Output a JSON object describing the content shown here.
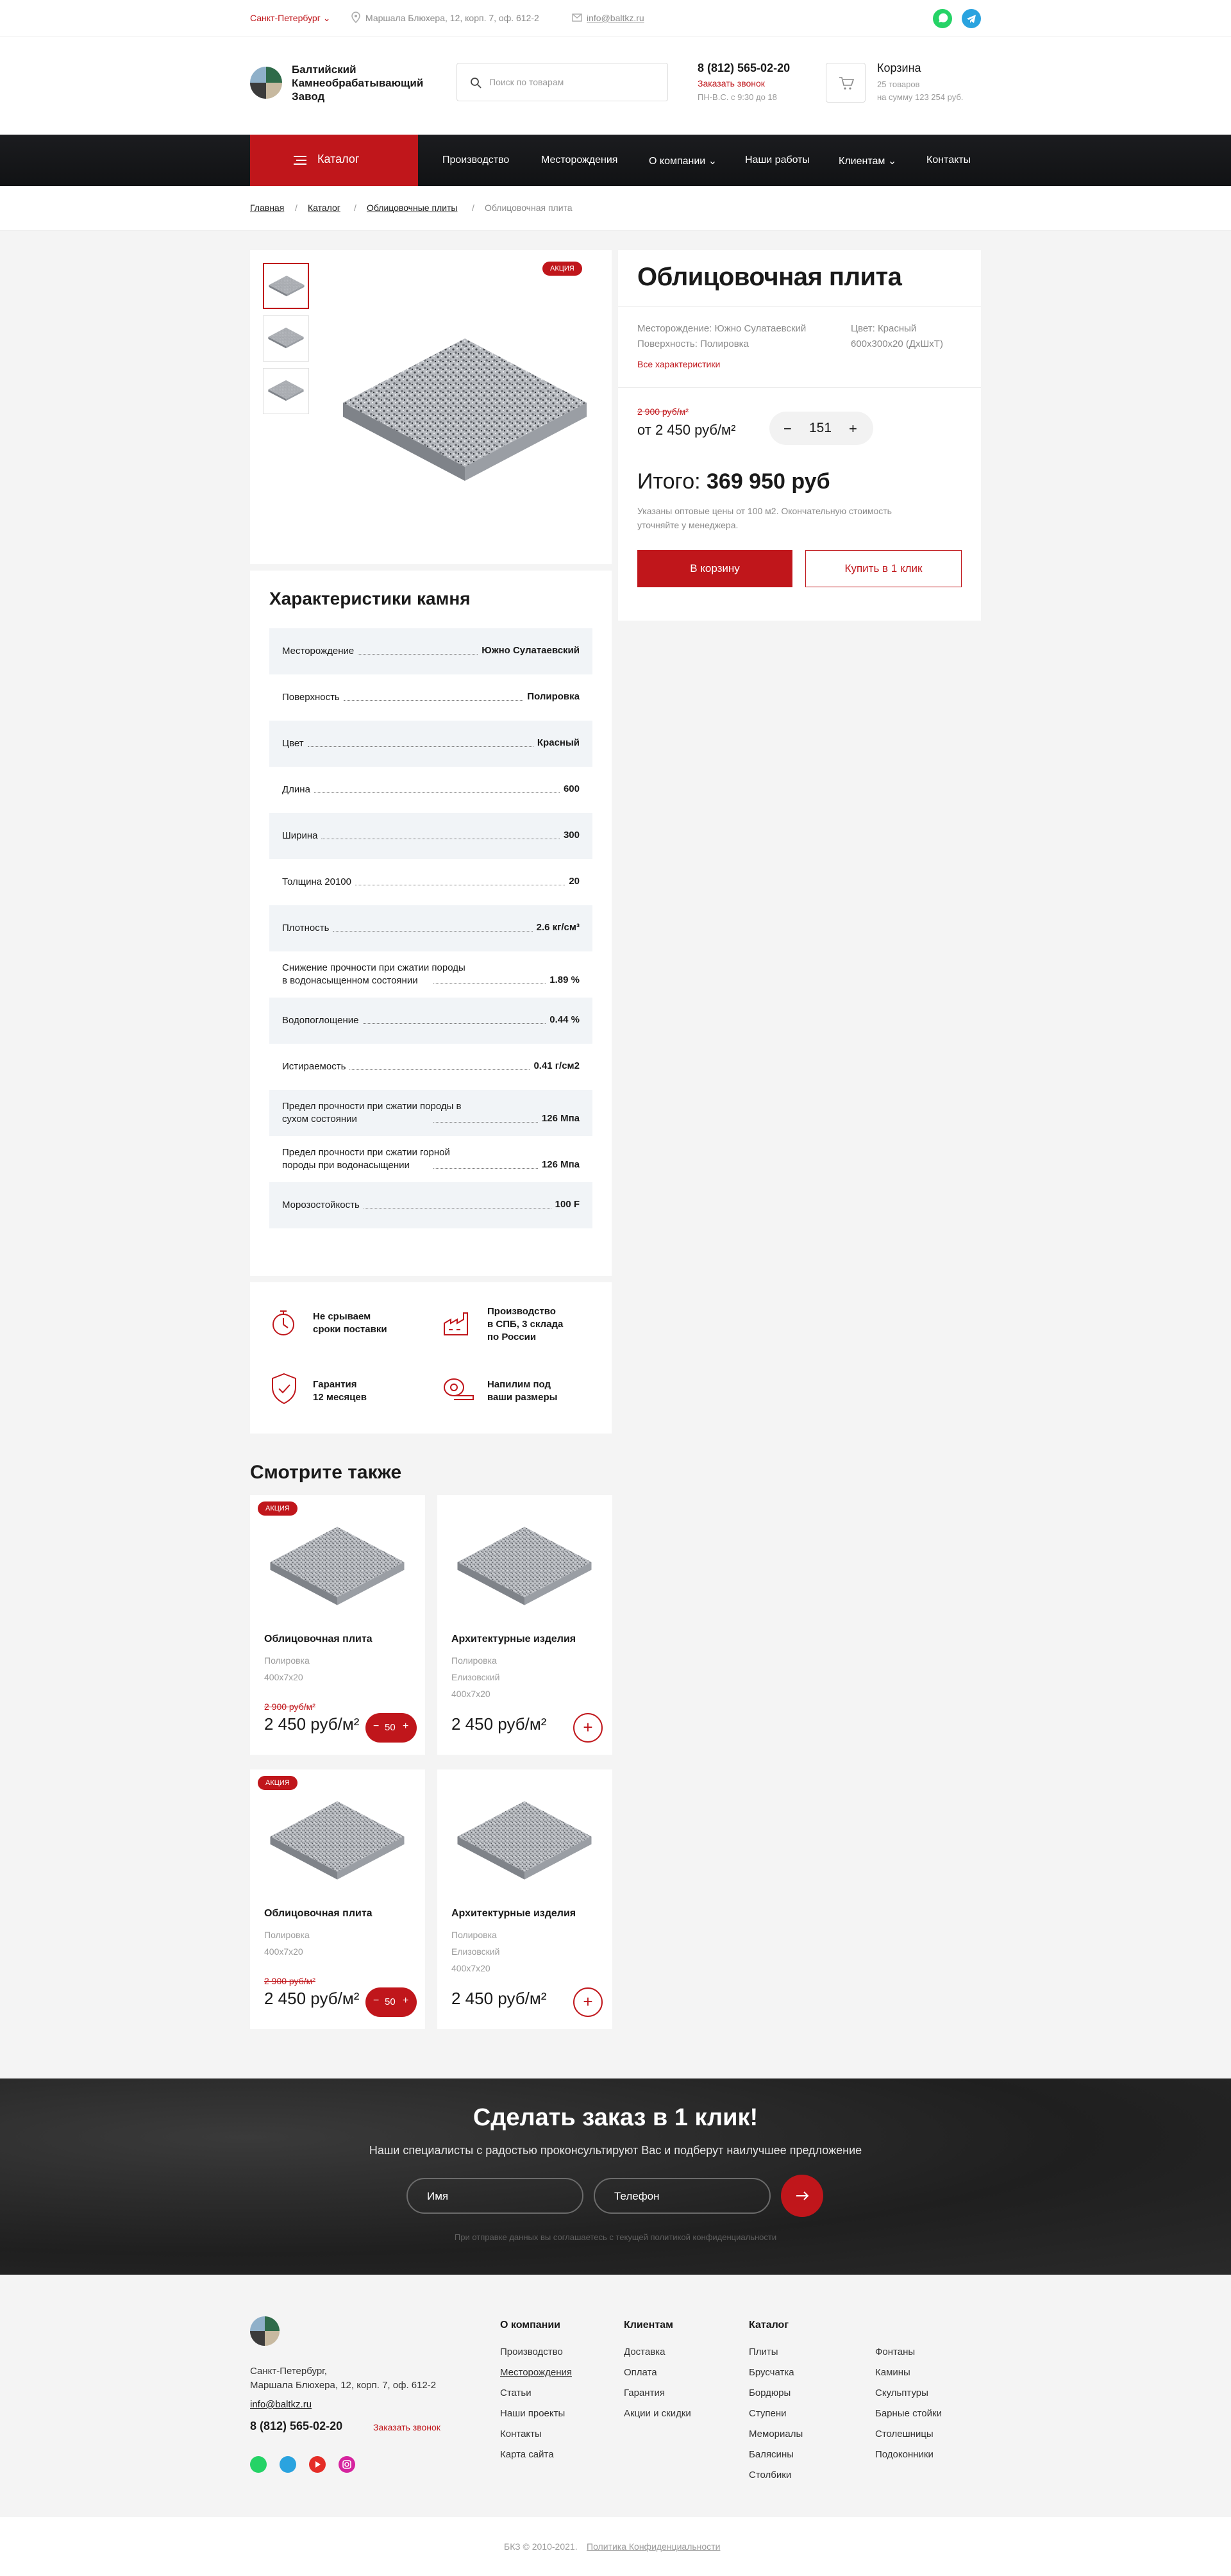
{
  "topbar": {
    "city": "Санкт-Петербург",
    "address": "Маршала Блюхера, 12, корп. 7, оф. 612-2",
    "email": "info@baltkz.ru",
    "whatsapp_color": "#25d366",
    "telegram_color": "#2aa3df"
  },
  "header": {
    "brand_line1": "Балтийский",
    "brand_line2": "Камнеобрабатывающий",
    "brand_line3": "Завод",
    "search_placeholder": "Поиск по товарам",
    "phone": "8 (812) 565-02-20",
    "callback": "Заказать звонок",
    "hours": "ПН-В.С. с 9:30 до 18",
    "cart_title": "Корзина",
    "cart_count": "25 товаров",
    "cart_sum": "на сумму 123 254 руб."
  },
  "nav": {
    "catalog": "Каталог",
    "items": [
      "Производство",
      "Месторождения",
      "О компании",
      "Наши работы",
      "Клиентам",
      "Контакты"
    ]
  },
  "breadcrumb": [
    "Главная",
    "Каталог",
    "Облицовочные плиты",
    "Облицовочная плита"
  ],
  "product": {
    "badge": "АКЦИЯ",
    "title": "Облицовочная плита",
    "deposit": "Месторождение: Южно Сулатаевский",
    "surface": "Поверхность: Полировка",
    "color": "Цвет: Красный",
    "size": "600х300х20 (ДхШхТ)",
    "all_chars": "Все характеристики",
    "old_price": "2 900 руб/м²",
    "price": "от 2 450 руб/м²",
    "qty_minus": "−",
    "qty": "151",
    "qty_plus": "+",
    "total_label": "Итого:",
    "total": "369 950 руб",
    "note": "Указаны оптовые цены от 100 м2. Окончательную стоимость уточняйте у менеджера.",
    "to_cart": "В корзину",
    "one_click": "Купить в 1 клик"
  },
  "specs": {
    "title": "Характеристики камня",
    "rows": [
      {
        "label": "Месторождение",
        "value": "Южно Сулатаевский"
      },
      {
        "label": "Поверхность",
        "value": "Полировка"
      },
      {
        "label": "Цвет",
        "value": "Красный"
      },
      {
        "label": "Длина",
        "value": "600"
      },
      {
        "label": "Ширина",
        "value": "300"
      },
      {
        "label": "Толщина 20100",
        "value": "20"
      },
      {
        "label": "Плотность",
        "value": "2.6 кг/см³"
      },
      {
        "label": "Снижение прочности при сжатии породы в водонасыщенном состоянии",
        "value": "1.89 %"
      },
      {
        "label": "Водопоглощение",
        "value": "0.44 %"
      },
      {
        "label": "Истираемость",
        "value": "0.41 г/см2"
      },
      {
        "label": "Предел прочности при сжатии породы в сухом состоянии",
        "value": "126 Мпа"
      },
      {
        "label": "Предел прочности при сжатии горной породы при водонасыщении",
        "value": "126 Мпа"
      },
      {
        "label": "Морозостойкость",
        "value": "100 F"
      }
    ]
  },
  "advantages": [
    {
      "line1": "Не срываем",
      "line2": "сроки поставки",
      "line3": ""
    },
    {
      "line1": "Производство",
      "line2": "в СПБ, 3 склада",
      "line3": "по России"
    },
    {
      "line1": "Гарантия",
      "line2": "12 месяцев",
      "line3": ""
    },
    {
      "line1": "Напилим под",
      "line2": "ваши размеры",
      "line3": ""
    }
  ],
  "see_also": {
    "title": "Смотрите также",
    "cards": [
      {
        "badge": "АКЦИЯ",
        "name": "Облицовочная плита",
        "d1": "Полировка",
        "d2": "400х7х20",
        "d3": "",
        "old": "2 900 руб/м²",
        "price": "2 450 руб/м²",
        "qty": "50"
      },
      {
        "badge": "",
        "name": "Архитектурные изделия",
        "d1": "Полировка",
        "d2": "Елизовский",
        "d3": "400х7х20",
        "old": "",
        "price": "2 450 руб/м²",
        "qty": ""
      },
      {
        "badge": "АКЦИЯ",
        "name": "Облицовочная плита",
        "d1": "Полировка",
        "d2": "400х7х20",
        "d3": "",
        "old": "2 900 руб/м²",
        "price": "2 450 руб/м²",
        "qty": "50"
      },
      {
        "badge": "",
        "name": "Архитектурные изделия",
        "d1": "Полировка",
        "d2": "Елизовский",
        "d3": "400х7х20",
        "old": "",
        "price": "2 450 руб/м²",
        "qty": ""
      }
    ]
  },
  "order": {
    "title": "Сделать заказ в 1 клик!",
    "subtitle": "Наши специалисты с радостью проконсультируют Вас и подберут наилучшее предложение",
    "name_ph": "Имя",
    "phone_ph": "Телефон",
    "policy": "При отправке данных вы соглашаетесь с текущей политикой конфиденциальности"
  },
  "footer": {
    "address1": "Санкт-Петербург,",
    "address2": "Маршала Блюхера, 12, корп. 7, оф. 612-2",
    "email": "info@baltkz.ru",
    "phone": "8 (812) 565-02-20",
    "callback": "Заказать звонок",
    "col1_title": "О компании",
    "col1": [
      "Производство",
      "Месторождения",
      "Статьи",
      "Наши проекты",
      "Контакты",
      "Карта сайта"
    ],
    "col2_title": "Клиентам",
    "col2": [
      "Доставка",
      "Оплата",
      "Гарантия",
      "Акции и скидки"
    ],
    "col3_title": "Каталог",
    "col3": [
      "Плиты",
      "Брусчатка",
      "Бордюры",
      "Ступени",
      "Мемориалы",
      "Балясины",
      "Столбики"
    ],
    "col4": [
      "Фонтаны",
      "Камины",
      "Скульптуры",
      "Барные стойки",
      "Столешницы",
      "Подоконники"
    ],
    "copyright": "БКЗ © 2010-2021.",
    "policy": "Политика Конфиденциальности"
  }
}
